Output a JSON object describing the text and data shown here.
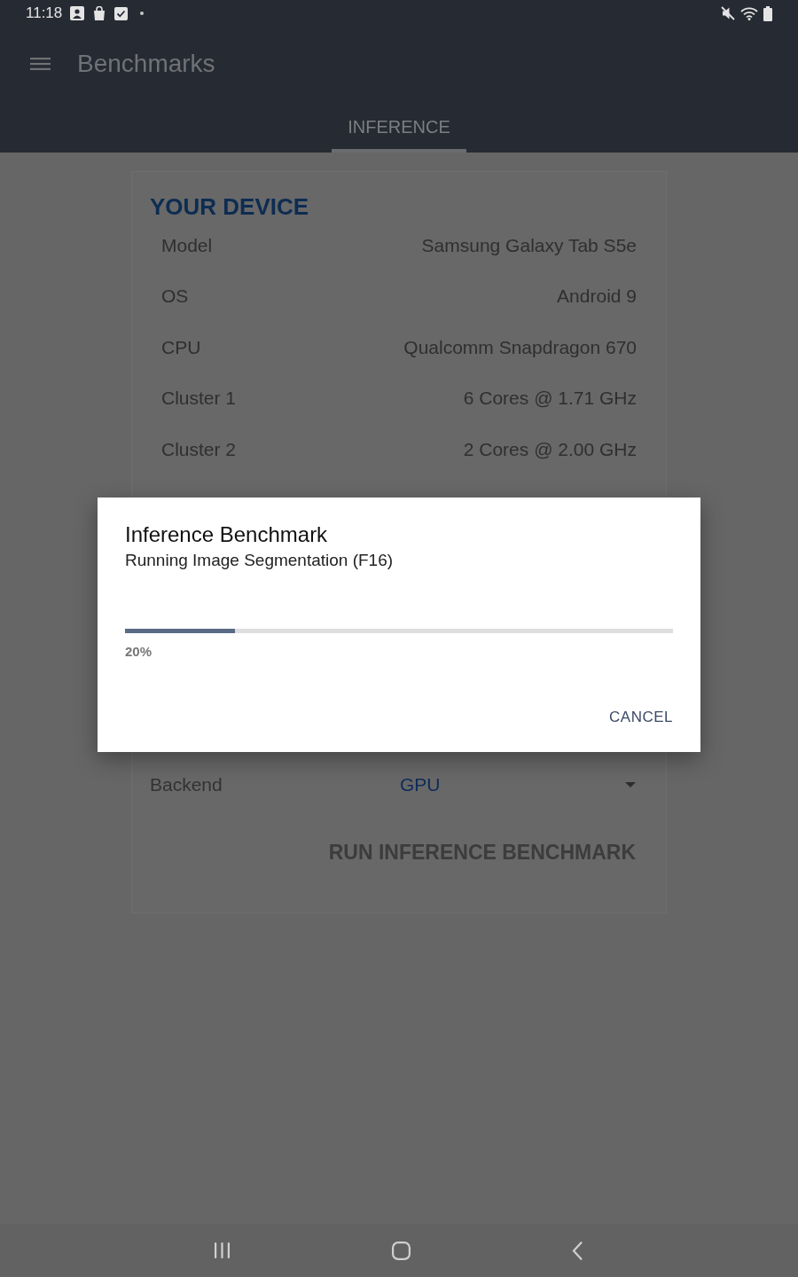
{
  "status_bar": {
    "time": "11:18"
  },
  "app_bar": {
    "title": "Benchmarks"
  },
  "tabs": [
    {
      "label": "INFERENCE",
      "selected": true
    }
  ],
  "device_card": {
    "heading": "YOUR DEVICE",
    "rows": [
      {
        "label": "Model",
        "value": "Samsung Galaxy Tab S5e"
      },
      {
        "label": "OS",
        "value": "Android 9"
      },
      {
        "label": "CPU",
        "value": "Qualcomm Snapdragon 670"
      },
      {
        "label": "Cluster 1",
        "value": "6 Cores @ 1.71 GHz"
      },
      {
        "label": "Cluster 2",
        "value": "2 Cores @ 2.00 GHz"
      }
    ],
    "backend": {
      "label": "Backend",
      "value": "GPU"
    },
    "run_button": {
      "label": "RUN INFERENCE BENCHMARK",
      "disabled": true
    }
  },
  "dialog": {
    "title": "Inference Benchmark",
    "message": "Running Image Segmentation (F16)",
    "progress": {
      "level": 0.2,
      "reading": "20%"
    },
    "buttons": [
      "CANCEL"
    ]
  }
}
